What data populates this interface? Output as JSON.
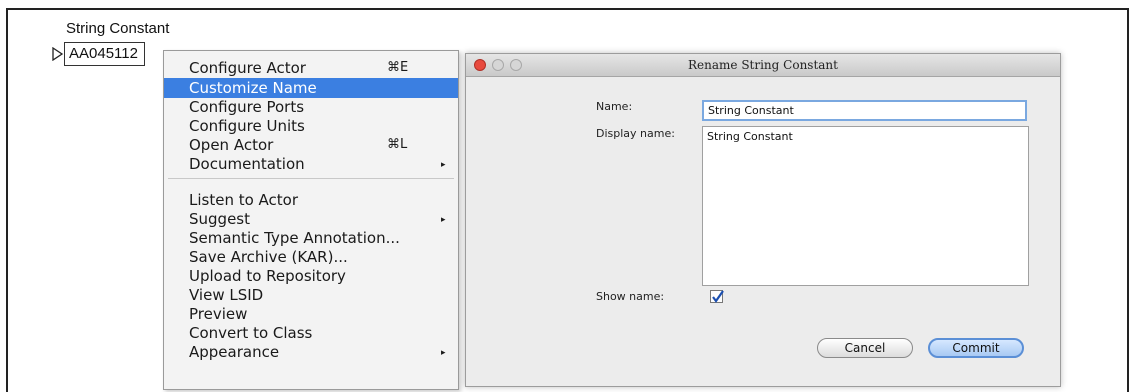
{
  "canvas": {
    "title": "String Constant",
    "actor_label": "AA045112"
  },
  "menu": {
    "items": [
      {
        "label": "Configure Actor",
        "shortcut": "⌘E",
        "submenu": false,
        "selected": false
      },
      {
        "label": "Customize Name",
        "shortcut": "",
        "submenu": false,
        "selected": true
      },
      {
        "label": "Configure Ports",
        "shortcut": "",
        "submenu": false,
        "selected": false
      },
      {
        "label": "Configure Units",
        "shortcut": "",
        "submenu": false,
        "selected": false
      },
      {
        "label": "Open Actor",
        "shortcut": "⌘L",
        "submenu": false,
        "selected": false
      },
      {
        "label": "Documentation",
        "shortcut": "",
        "submenu": true,
        "selected": false
      },
      {
        "label": "Listen to Actor",
        "shortcut": "",
        "submenu": false,
        "selected": false
      },
      {
        "label": "Suggest",
        "shortcut": "",
        "submenu": true,
        "selected": false
      },
      {
        "label": "Semantic Type Annotation...",
        "shortcut": "",
        "submenu": false,
        "selected": false
      },
      {
        "label": "Save Archive (KAR)...",
        "shortcut": "",
        "submenu": false,
        "selected": false
      },
      {
        "label": "Upload to Repository",
        "shortcut": "",
        "submenu": false,
        "selected": false
      },
      {
        "label": "View LSID",
        "shortcut": "",
        "submenu": false,
        "selected": false
      },
      {
        "label": "Preview",
        "shortcut": "",
        "submenu": false,
        "selected": false
      },
      {
        "label": "Convert to Class",
        "shortcut": "",
        "submenu": false,
        "selected": false
      },
      {
        "label": "Appearance",
        "shortcut": "",
        "submenu": true,
        "selected": false
      }
    ],
    "submenu_arrow": "▸",
    "selection_color": "#3b7fe1"
  },
  "dialog": {
    "title": "Rename String Constant",
    "name_label": "Name:",
    "name_value": "String Constant",
    "display_name_label": "Display name:",
    "display_name_value": "String Constant",
    "show_name_label": "Show name:",
    "show_name_checked": true,
    "cancel_label": "Cancel",
    "commit_label": "Commit"
  }
}
